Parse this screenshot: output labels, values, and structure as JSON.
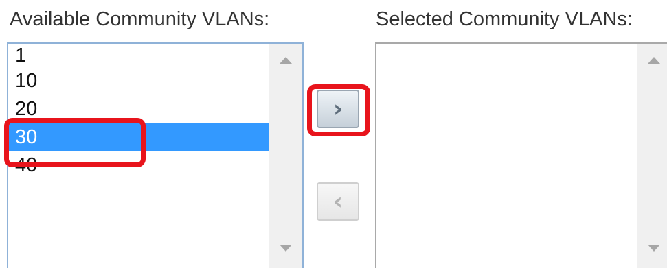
{
  "available": {
    "label": "Available Community VLANs:",
    "items": [
      "1",
      "10",
      "20",
      "30",
      "40"
    ],
    "selected_item": "30"
  },
  "selected": {
    "label": "Selected Community VLANs:",
    "items": []
  },
  "buttons": {
    "add_glyph": "›",
    "remove_glyph": "‹"
  },
  "colors": {
    "selection": "#3399ff",
    "highlight": "#e8141c",
    "text": "#333333"
  },
  "icons": {
    "add": "chevron-right-icon",
    "remove": "chevron-left-icon",
    "scroll_up": "triangle-up-icon",
    "scroll_down": "triangle-down-icon"
  }
}
